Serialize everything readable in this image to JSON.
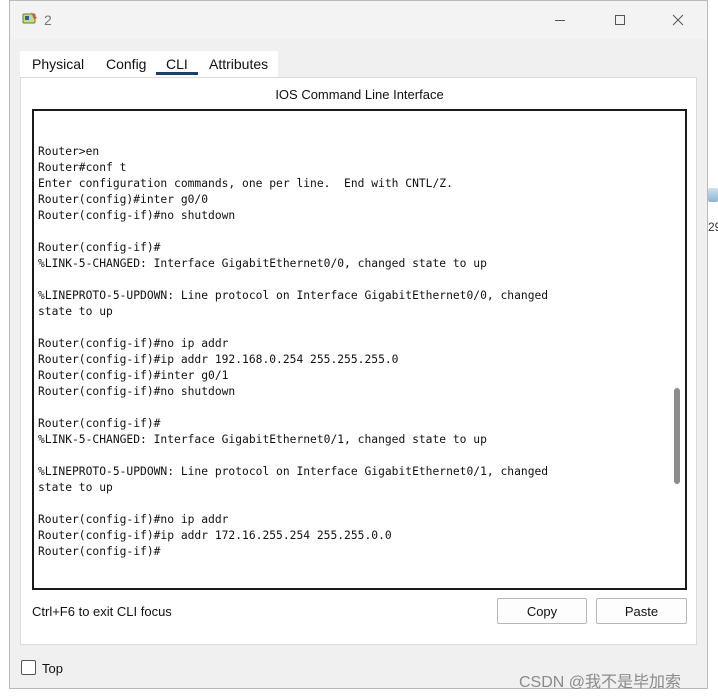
{
  "window": {
    "title": "2",
    "icons": {
      "app": "router-icon",
      "minimize": "minimize-icon",
      "maximize": "maximize-icon",
      "close": "close-icon"
    }
  },
  "tabs": [
    {
      "label": "Physical"
    },
    {
      "label": "Config"
    },
    {
      "label": "CLI",
      "active": true
    },
    {
      "label": "Attributes"
    }
  ],
  "cli": {
    "header": "IOS Command Line Interface",
    "output": "Router>en\nRouter#conf t\nEnter configuration commands, one per line.  End with CNTL/Z.\nRouter(config)#inter g0/0\nRouter(config-if)#no shutdown\n\nRouter(config-if)#\n%LINK-5-CHANGED: Interface GigabitEthernet0/0, changed state to up\n\n%LINEPROTO-5-UPDOWN: Line protocol on Interface GigabitEthernet0/0, changed\nstate to up\n\nRouter(config-if)#no ip addr\nRouter(config-if)#ip addr 192.168.0.254 255.255.255.0\nRouter(config-if)#inter g0/1\nRouter(config-if)#no shutdown\n\nRouter(config-if)#\n%LINK-5-CHANGED: Interface GigabitEthernet0/1, changed state to up\n\n%LINEPROTO-5-UPDOWN: Line protocol on Interface GigabitEthernet0/1, changed\nstate to up\n\nRouter(config-if)#no ip addr\nRouter(config-if)#ip addr 172.16.255.254 255.255.0.0\nRouter(config-if)#",
    "hint": "Ctrl+F6 to exit CLI focus",
    "copy_label": "Copy",
    "paste_label": "Paste"
  },
  "footer": {
    "top_label": "Top",
    "top_checked": false
  },
  "background": {
    "right_number": "29"
  },
  "watermark": "CSDN @我不是毕加索",
  "colors": {
    "tab_underline": "#1d3f6b",
    "window_bg": "#f0f0f0"
  }
}
